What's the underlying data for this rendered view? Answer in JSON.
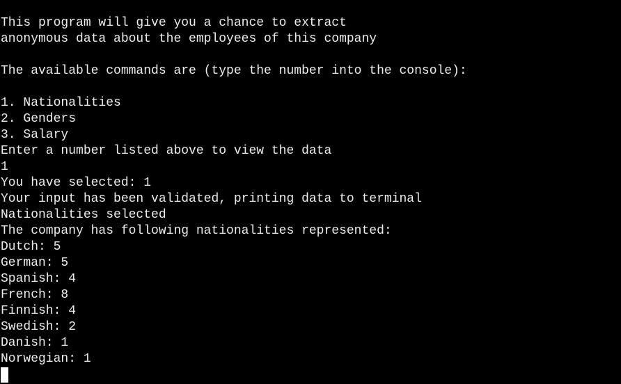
{
  "intro": {
    "line1": "This program will give you a chance to extract",
    "line2": "anonymous data about the employees of this company"
  },
  "commands_header": "The available commands are (type the number into the console):",
  "commands": [
    "1. Nationalities",
    "2. Genders",
    "3. Salary"
  ],
  "prompt": "Enter a number listed above to view the data",
  "user_input": "1",
  "selected": "You have selected: 1",
  "validated": "Your input has been validated, printing data to terminal",
  "selection_label": "Nationalities selected",
  "result_header": "The company has following nationalities represented:",
  "nationalities": [
    "Dutch: 5",
    "German: 5",
    "Spanish: 4",
    "French: 8",
    "Finnish: 4",
    "Swedish: 2",
    "Danish: 1",
    "Norwegian: 1"
  ],
  "colors": {
    "background": "#000000",
    "foreground": "#ececec",
    "cursor": "#ffffff"
  }
}
